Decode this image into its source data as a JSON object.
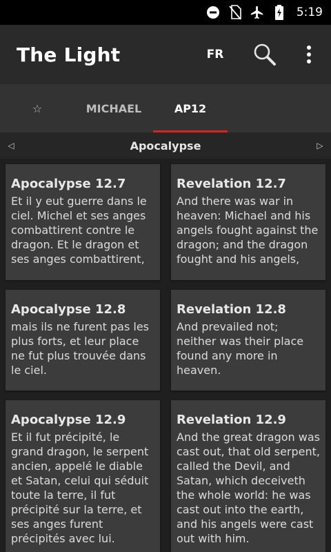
{
  "status_bar": {
    "icons": [
      "do-not-disturb-icon",
      "no-sim-icon",
      "airplane-mode-icon",
      "battery-charging-icon"
    ],
    "time": "5:19"
  },
  "app_bar": {
    "title": "The Light",
    "language": "FR",
    "icons": [
      "search-icon",
      "overflow-menu-icon"
    ]
  },
  "tabs": [
    {
      "label": "☆",
      "active": false
    },
    {
      "label": "MICHAEL",
      "active": false
    },
    {
      "label": "AP12",
      "active": true
    }
  ],
  "colors": {
    "accent": "#e02020",
    "card": "#3c3c3c",
    "app_bar": "#2a2a2a",
    "tab_bar": "#333333"
  },
  "book_nav": {
    "prev_arrow": "◁",
    "title": "Apocalypse",
    "next_arrow": "▷"
  },
  "verses": [
    {
      "left": {
        "ref": "Apocalypse 12.7",
        "text": "Et il y eut guerre dans le ciel. Michel et ses anges combattirent contre le dragon. Et le dragon et ses anges combattirent,"
      },
      "right": {
        "ref": "Revelation 12.7",
        "text": "And there was war in heaven: Michael and his angels fought against the dragon; and the dragon fought and his angels,"
      }
    },
    {
      "left": {
        "ref": "Apocalypse 12.8",
        "text": "mais ils ne furent pas les plus forts, et leur place ne fut plus trouvée dans le ciel."
      },
      "right": {
        "ref": "Revelation 12.8",
        "text": "And prevailed not; neither was their place found any more in heaven."
      }
    },
    {
      "left": {
        "ref": "Apocalypse 12.9",
        "text": "Et il fut précipité, le grand dragon, le serpent ancien, appelé le diable et Satan, celui qui séduit toute la terre, il fut précipité sur la terre, et ses anges furent précipités avec lui."
      },
      "right": {
        "ref": "Revelation 12.9",
        "text": "And the great dragon was cast out, that old serpent, called the Devil, and Satan, which deceiveth the whole world: he was cast out into the earth, and his angels were cast out with him."
      }
    }
  ]
}
